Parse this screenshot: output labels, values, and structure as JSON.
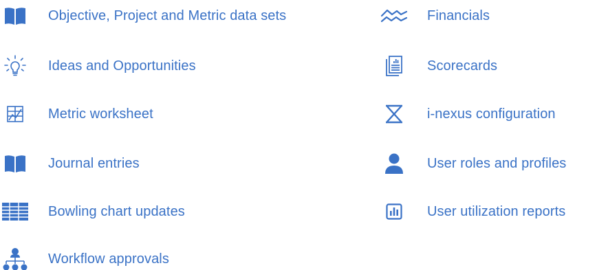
{
  "accent_color": "#3a72c6",
  "left_column": [
    {
      "icon": "book-icon",
      "label": "Objective, Project and Metric data sets"
    },
    {
      "icon": "lightbulb-icon",
      "label": "Ideas and Opportunities"
    },
    {
      "icon": "worksheet-icon",
      "label": "Metric worksheet"
    },
    {
      "icon": "book-icon",
      "label": "Journal entries"
    },
    {
      "icon": "table-grid-icon",
      "label": "Bowling chart updates"
    },
    {
      "icon": "org-chart-icon",
      "label": "Workflow approvals"
    }
  ],
  "right_column": [
    {
      "icon": "wave-chart-icon",
      "label": "Financials"
    },
    {
      "icon": "documents-icon",
      "label": "Scorecards"
    },
    {
      "icon": "x-box-icon",
      "label": "i-nexus configuration"
    },
    {
      "icon": "user-icon",
      "label": "User roles and profiles"
    },
    {
      "icon": "bar-report-icon",
      "label": "User utilization reports"
    }
  ]
}
